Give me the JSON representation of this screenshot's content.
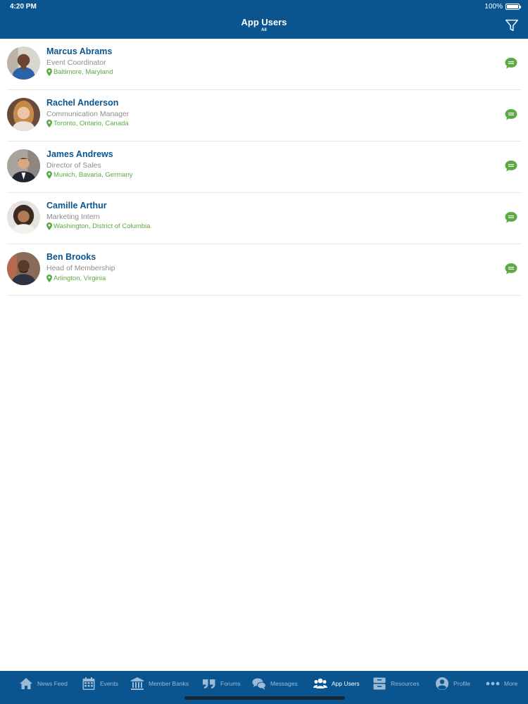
{
  "status": {
    "time": "4:20 PM",
    "battery": "100%"
  },
  "header": {
    "title": "App Users",
    "subtitle": "All"
  },
  "users": [
    {
      "name": "Marcus Abrams",
      "role": "Event Coordinator",
      "location": "Baltimore, Maryland"
    },
    {
      "name": "Rachel Anderson",
      "role": "Communication Manager",
      "location": "Toronto, Ontario, Canada"
    },
    {
      "name": "James Andrews",
      "role": "Director of Sales",
      "location": "Munich, Bavaria, Germany"
    },
    {
      "name": "Camille Arthur",
      "role": "Marketing Intern",
      "location": "Washington, District of Columbia"
    },
    {
      "name": "Ben Brooks",
      "role": "Head of Membership",
      "location": "Arlington, Virginia"
    }
  ],
  "tabs": [
    {
      "label": "News Feed",
      "icon": "home-icon"
    },
    {
      "label": "Events",
      "icon": "calendar-icon"
    },
    {
      "label": "Member Banks",
      "icon": "bank-icon"
    },
    {
      "label": "Forums",
      "icon": "quote-icon"
    },
    {
      "label": "Messages",
      "icon": "chat-bubbles-icon"
    },
    {
      "label": "App Users",
      "icon": "users-icon",
      "active": true
    },
    {
      "label": "Resources",
      "icon": "archive-icon"
    },
    {
      "label": "Profile",
      "icon": "profile-icon"
    },
    {
      "label": "More",
      "icon": "more-icon"
    }
  ],
  "colors": {
    "brand": "#0a5590",
    "accent_green": "#5daa45",
    "inactive_tab": "#9cbad5"
  }
}
